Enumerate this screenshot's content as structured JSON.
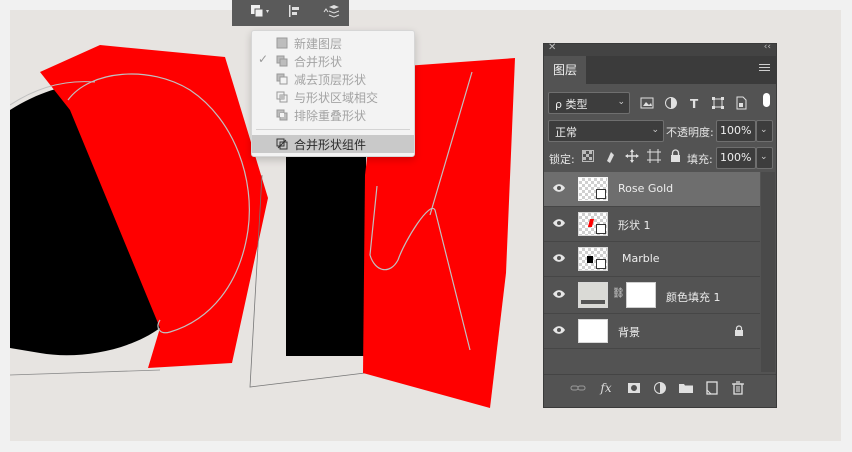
{
  "dropdown": {
    "items": [
      {
        "label": "新建图层",
        "checked": false
      },
      {
        "label": "合并形状",
        "checked": true
      },
      {
        "label": "减去顶层形状",
        "checked": false
      },
      {
        "label": "与形状区域相交",
        "checked": false
      },
      {
        "label": "排除重叠形状",
        "checked": false
      }
    ],
    "merge_components": {
      "label": "合并形状组件",
      "highlighted": true
    }
  },
  "layers_panel": {
    "tab_label": "图层",
    "filter": {
      "label": "ρ 类型"
    },
    "blend_mode": "正常",
    "opacity_label": "不透明度:",
    "opacity_value": "100%",
    "lock_label": "锁定:",
    "fill_label": "填充:",
    "fill_value": "100%",
    "layers": [
      {
        "name": "Rose Gold",
        "selected": true,
        "type": "shape"
      },
      {
        "name": "形状 1",
        "selected": false,
        "type": "shape"
      },
      {
        "name": "Marble",
        "selected": false,
        "type": "shape"
      },
      {
        "name": "颜色填充 1",
        "selected": false,
        "type": "fill"
      },
      {
        "name": "背景",
        "selected": false,
        "type": "background",
        "locked": true
      }
    ],
    "bottom_icons": [
      "link-layers-icon",
      "fx-icon",
      "add-mask-icon",
      "adjustment-layer-icon",
      "new-group-icon",
      "new-layer-icon",
      "delete-layer-icon"
    ]
  },
  "colors": {
    "canvas_bg": "#e7e4e1",
    "shape_red": "#ff0000",
    "shape_black": "#000000",
    "panel_bg": "#535353",
    "selected_row": "#6e6e6e"
  }
}
